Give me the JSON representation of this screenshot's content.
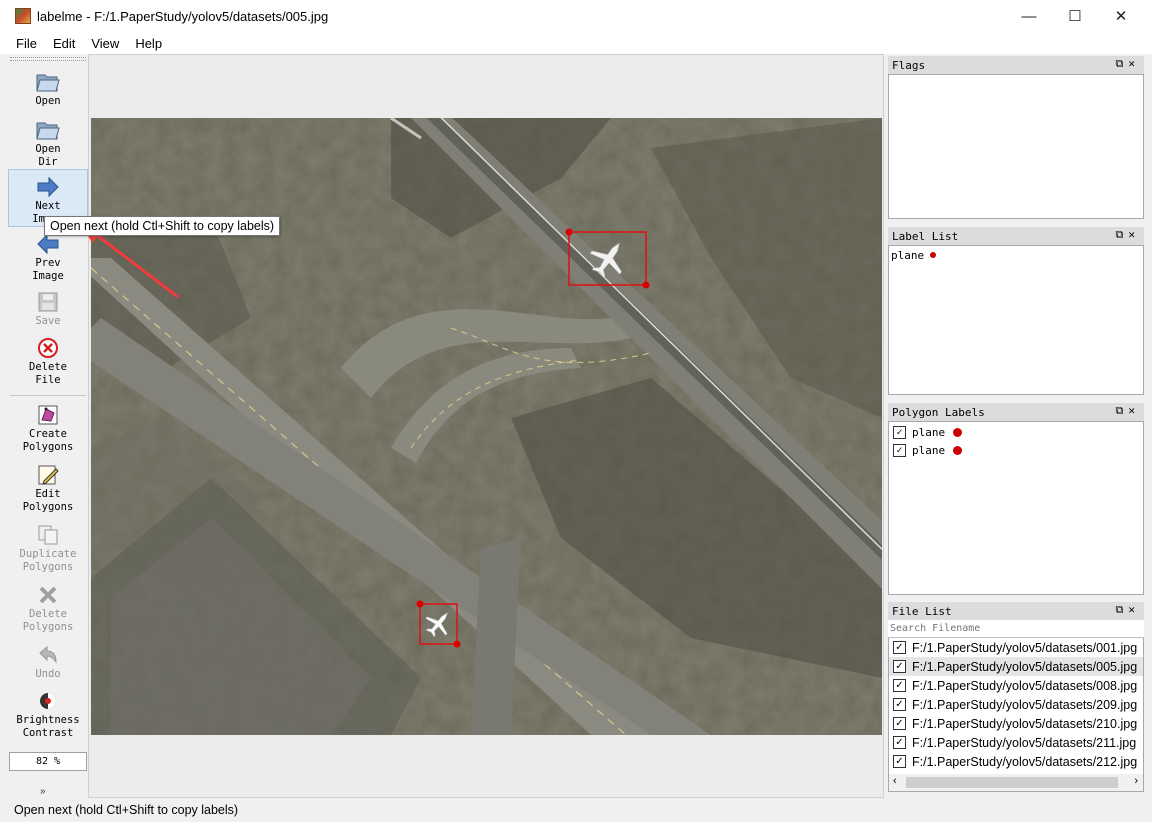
{
  "window": {
    "title": "labelme - F:/1.PaperStudy/yolov5/datasets/005.jpg",
    "min": "—",
    "max": "☐",
    "close": "✕"
  },
  "menu": [
    "File",
    "Edit",
    "View",
    "Help"
  ],
  "toolbar": {
    "items": [
      {
        "label": "Open",
        "icon": "folder-open-icon",
        "enabled": true
      },
      {
        "label": "Open\nDir",
        "icon": "folder-open-icon",
        "enabled": true
      },
      {
        "label": "Next\nImage",
        "icon": "arrow-right-icon",
        "enabled": true
      },
      {
        "label": "Prev\nImage",
        "icon": "arrow-left-icon",
        "enabled": true
      },
      {
        "label": "Save",
        "icon": "save-icon",
        "enabled": false
      },
      {
        "label": "Delete\nFile",
        "icon": "delete-file-icon",
        "enabled": true
      },
      {
        "label": "Create\nPolygons",
        "icon": "create-polygon-icon",
        "enabled": true
      },
      {
        "label": "Edit\nPolygons",
        "icon": "edit-polygon-icon",
        "enabled": true
      },
      {
        "label": "Duplicate\nPolygons",
        "icon": "duplicate-icon",
        "enabled": false
      },
      {
        "label": "Delete\nPolygons",
        "icon": "cross-icon",
        "enabled": false
      },
      {
        "label": "Undo",
        "icon": "undo-icon",
        "enabled": false
      },
      {
        "label": "Brightness\nContrast",
        "icon": "brightness-icon",
        "enabled": true
      }
    ],
    "zoom": "82 %",
    "more": "»"
  },
  "tooltip": "Open next (hold Ctl+Shift to copy labels)",
  "docks": {
    "flags": {
      "title": "Flags"
    },
    "label_list": {
      "title": "Label List",
      "items": [
        {
          "label": "plane",
          "color": "#cc0000"
        }
      ]
    },
    "polygon_labels": {
      "title": "Polygon Labels",
      "items": [
        {
          "label": "plane",
          "checked": true,
          "color": "#cc0000"
        },
        {
          "label": "plane",
          "checked": true,
          "color": "#cc0000"
        }
      ]
    },
    "file_list": {
      "title": "File List",
      "search_placeholder": "Search Filename",
      "files": [
        "F:/1.PaperStudy/yolov5/datasets/001.jpg",
        "F:/1.PaperStudy/yolov5/datasets/005.jpg",
        "F:/1.PaperStudy/yolov5/datasets/008.jpg",
        "F:/1.PaperStudy/yolov5/datasets/209.jpg",
        "F:/1.PaperStudy/yolov5/datasets/210.jpg",
        "F:/1.PaperStudy/yolov5/datasets/211.jpg",
        "F:/1.PaperStudy/yolov5/datasets/212.jpg"
      ],
      "selected_file": "F:/1.PaperStudy/yolov5/datasets/005.jpg"
    }
  },
  "status": "Open next (hold Ctl+Shift to copy labels)",
  "colors": {
    "box": "#e01010",
    "vertex": "#dd0000",
    "annotation_arrow": "#f03c3c"
  }
}
